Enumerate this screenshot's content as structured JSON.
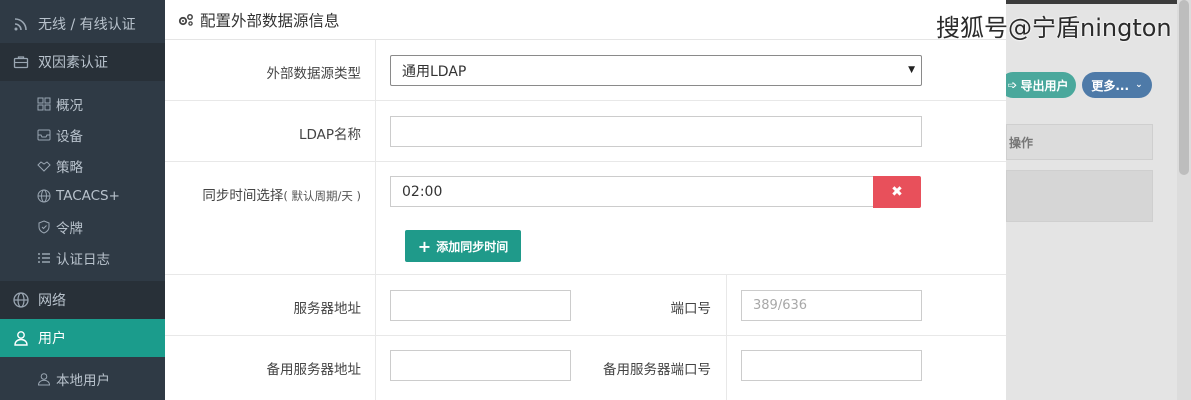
{
  "sidebar": {
    "items": [
      {
        "label": "无线 / 有线认证",
        "icon": "wifi-icon"
      },
      {
        "label": "双因素认证",
        "icon": "briefcase-icon"
      },
      {
        "label": "概况",
        "icon": "grid-icon"
      },
      {
        "label": "设备",
        "icon": "inbox-icon"
      },
      {
        "label": "策略",
        "icon": "handshake-icon"
      },
      {
        "label": "TACACS+",
        "icon": "globe-icon"
      },
      {
        "label": "令牌",
        "icon": "shield-icon"
      },
      {
        "label": "认证日志",
        "icon": "list-icon"
      },
      {
        "label": "网络",
        "icon": "globe-icon"
      },
      {
        "label": "用户",
        "icon": "user-icon"
      },
      {
        "label": "本地用户",
        "icon": "user-outline-icon"
      }
    ]
  },
  "background": {
    "export_label": "导出用户",
    "more_label": "更多...",
    "op_header": "操作"
  },
  "watermark": "搜狐号@宁盾nington",
  "modal": {
    "title": "配置外部数据源信息",
    "fields": {
      "source_type_label": "外部数据源类型",
      "source_type_value": "通用LDAP",
      "ldap_name_label": "LDAP名称",
      "ldap_name_value": "",
      "sync_label": "同步时间选择",
      "sync_hint": "( 默认周期/天 )",
      "sync_time_value": "02:00",
      "remove_symbol": "✖",
      "add_sync_label": "添加同步时间",
      "server_addr_label": "服务器地址",
      "server_addr_value": "",
      "port_label": "端口号",
      "port_placeholder": "389/636",
      "backup_server_label": "备用服务器地址",
      "backup_server_value": "",
      "backup_port_label": "备用服务器端口号",
      "backup_port_value": ""
    }
  },
  "colors": {
    "sidebar_bg": "#2f3a45",
    "active": "#1b9c8c",
    "danger": "#e8505b",
    "teal": "#1f9a8a"
  }
}
